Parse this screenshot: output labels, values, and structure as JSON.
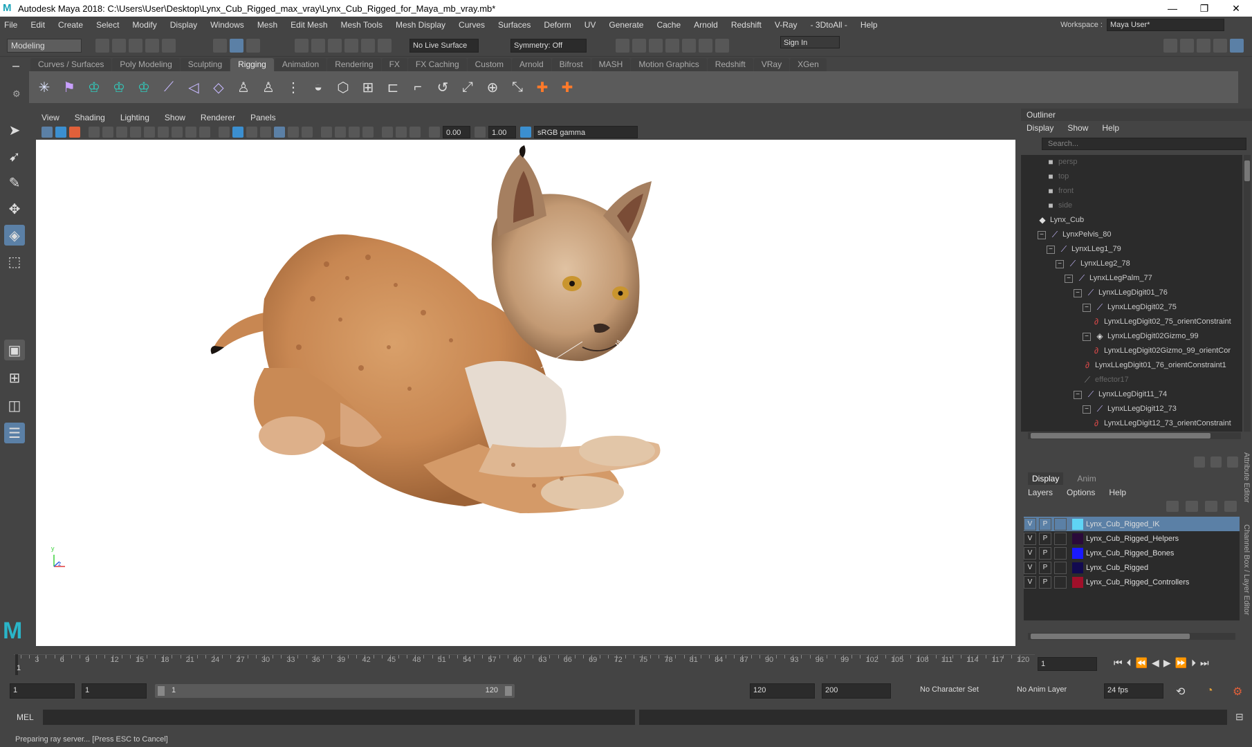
{
  "window": {
    "title": "Autodesk Maya 2018: C:\\Users\\User\\Desktop\\Lynx_Cub_Rigged_max_vray\\Lynx_Cub_Rigged_for_Maya_mb_vray.mb*",
    "minimize": "—",
    "maximize": "❐",
    "close": "✕"
  },
  "menubar": {
    "items": [
      "File",
      "Edit",
      "Create",
      "Select",
      "Modify",
      "Display",
      "Windows",
      "Mesh",
      "Edit Mesh",
      "Mesh Tools",
      "Mesh Display",
      "Curves",
      "Surfaces",
      "Deform",
      "UV",
      "Generate",
      "Cache",
      "Arnold",
      "Redshift",
      "V-Ray",
      "- 3DtoAll -",
      "Help"
    ],
    "workspace_label": "Workspace :",
    "workspace_value": "Maya User*"
  },
  "statusline": {
    "mode": "Modeling",
    "live_surface": "No Live Surface",
    "symmetry": "Symmetry: Off",
    "sign_in": "Sign In"
  },
  "shelf": {
    "tabs": [
      "Curves / Surfaces",
      "Poly Modeling",
      "Sculpting",
      "Rigging",
      "Animation",
      "Rendering",
      "FX",
      "FX Caching",
      "Custom",
      "Arnold",
      "Bifrost",
      "MASH",
      "Motion Graphics",
      "Redshift",
      "VRay",
      "XGen"
    ],
    "active_tab": "Rigging"
  },
  "viewport": {
    "menu": [
      "View",
      "Shading",
      "Lighting",
      "Show",
      "Renderer",
      "Panels"
    ],
    "exposure": "0.00",
    "gamma": "1.00",
    "color_space": "sRGB gamma",
    "axis_y": "y",
    "axis_z": "z"
  },
  "outliner": {
    "title": "Outliner",
    "menu": [
      "Display",
      "Show",
      "Help"
    ],
    "search_placeholder": "Search...",
    "items": [
      {
        "label": "persp",
        "indent": 0,
        "icon": "camera-icon",
        "dim": true
      },
      {
        "label": "top",
        "indent": 0,
        "icon": "camera-icon",
        "dim": true
      },
      {
        "label": "front",
        "indent": 0,
        "icon": "camera-icon",
        "dim": true
      },
      {
        "label": "side",
        "indent": 0,
        "icon": "camera-icon",
        "dim": true
      },
      {
        "label": "Lynx_Cub",
        "indent": 0,
        "icon": "mesh-icon"
      },
      {
        "label": "LynxPelvis_80",
        "indent": 0,
        "icon": "joint-icon",
        "expand": "⊟"
      },
      {
        "label": "LynxLLeg1_79",
        "indent": 1,
        "icon": "joint-icon",
        "expand": "⊟"
      },
      {
        "label": "LynxLLeg2_78",
        "indent": 2,
        "icon": "joint-icon",
        "expand": "⊟"
      },
      {
        "label": "LynxLLegPalm_77",
        "indent": 3,
        "icon": "joint-icon",
        "expand": "⊟"
      },
      {
        "label": "LynxLLegDigit01_76",
        "indent": 4,
        "icon": "joint-icon",
        "expand": "⊟"
      },
      {
        "label": "LynxLLegDigit02_75",
        "indent": 5,
        "icon": "joint-icon",
        "expand": "⊟"
      },
      {
        "label": "LynxLLegDigit02_75_orientConstraint",
        "indent": 6,
        "icon": "constraint-icon"
      },
      {
        "label": "LynxLLegDigit02Gizmo_99",
        "indent": 5,
        "icon": "locator-icon",
        "expand": "⊟"
      },
      {
        "label": "LynxLLegDigit02Gizmo_99_orientCor",
        "indent": 6,
        "icon": "constraint-icon"
      },
      {
        "label": "LynxLLegDigit01_76_orientConstraint1",
        "indent": 5,
        "icon": "constraint-icon"
      },
      {
        "label": "effector17",
        "indent": 5,
        "icon": "effector-icon",
        "dim": true
      },
      {
        "label": "LynxLLegDigit11_74",
        "indent": 4,
        "icon": "joint-icon",
        "expand": "⊟"
      },
      {
        "label": "LynxLLegDigit12_73",
        "indent": 5,
        "icon": "joint-icon",
        "expand": "⊟"
      },
      {
        "label": "LynxLLegDigit12_73_orientConstraint",
        "indent": 6,
        "icon": "constraint-icon"
      }
    ]
  },
  "layers": {
    "tabs": [
      "Display",
      "Anim"
    ],
    "menu": [
      "Layers",
      "Options",
      "Help"
    ],
    "rows": [
      {
        "v": "V",
        "p": "P",
        "color": "#5fd4f5",
        "name": "Lynx_Cub_Rigged_IK",
        "selected": true
      },
      {
        "v": "V",
        "p": "P",
        "color": "#2a0a3a",
        "name": "Lynx_Cub_Rigged_Helpers"
      },
      {
        "v": "V",
        "p": "P",
        "color": "#1a1aff",
        "name": "Lynx_Cub_Rigged_Bones"
      },
      {
        "v": "V",
        "p": "P",
        "color": "#120a50",
        "name": "Lynx_Cub_Rigged"
      },
      {
        "v": "V",
        "p": "P",
        "color": "#a0102a",
        "name": "Lynx_Cub_Rigged_Controllers"
      }
    ],
    "side_labels": [
      "Attribute Editor",
      "Channel Box / Layer Editor"
    ]
  },
  "timeline": {
    "ticks": [
      "3",
      "6",
      "9",
      "12",
      "15",
      "18",
      "21",
      "24",
      "27",
      "30",
      "33",
      "36",
      "39",
      "42",
      "45",
      "48",
      "51",
      "54",
      "57",
      "60",
      "63",
      "66",
      "69",
      "72",
      "75",
      "78",
      "81",
      "84",
      "87",
      "90",
      "93",
      "96",
      "99",
      "102",
      "105",
      "108",
      "111",
      "114",
      "117",
      "120"
    ],
    "current_marker": "1",
    "current_frame": "1"
  },
  "range": {
    "start": "1",
    "playback_start": "1",
    "slider_start": "1",
    "slider_end": "120",
    "playback_end": "120",
    "end": "200",
    "character_set": "No Character Set",
    "anim_layer": "No Anim Layer",
    "fps": "24 fps"
  },
  "mel": {
    "label": "MEL"
  },
  "help_line": {
    "text": "Preparing ray server... [Press ESC to Cancel]"
  }
}
